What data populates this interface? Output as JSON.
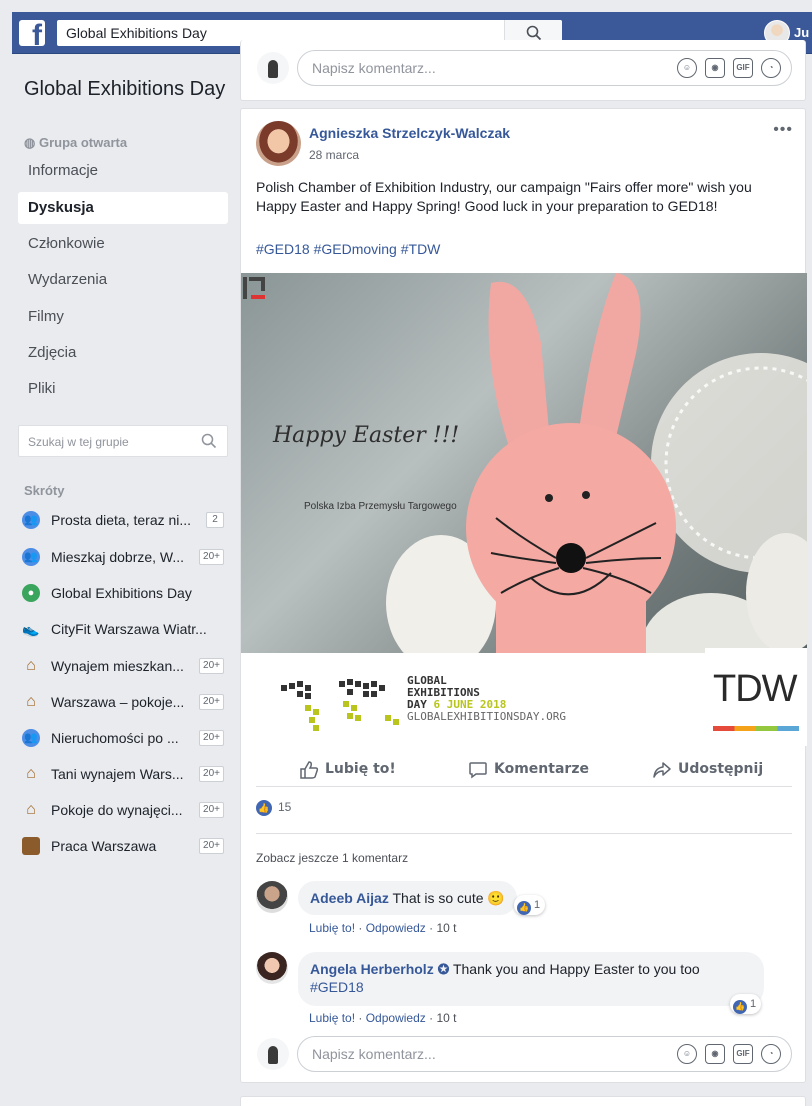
{
  "topbar": {
    "search_value": "Global Exhibitions Day",
    "user_short": "Ju"
  },
  "sidebar": {
    "group_title": "Global Exhibitions Day",
    "group_type": "Grupa otwarta",
    "nav": [
      "Informacje",
      "Dyskusja",
      "Członkowie",
      "Wydarzenia",
      "Filmy",
      "Zdjęcia",
      "Pliki"
    ],
    "active_nav": "Dyskusja",
    "search_placeholder": "Szukaj w tej grupie",
    "shortcuts_title": "Skróty",
    "shortcuts": [
      {
        "label": "Prosta dieta, teraz ni...",
        "badge": "2",
        "icon": "group-icon"
      },
      {
        "label": "Mieszkaj dobrze, W...",
        "badge": "20+",
        "icon": "group-icon"
      },
      {
        "label": "Global Exhibitions Day",
        "badge": "",
        "icon": "globe-icon"
      },
      {
        "label": "CityFit Warszawa Wiatr...",
        "badge": "",
        "icon": "shoe-icon"
      },
      {
        "label": "Wynajem mieszkan...",
        "badge": "20+",
        "icon": "house-icon"
      },
      {
        "label": "Warszawa – pokoje...",
        "badge": "20+",
        "icon": "house-icon"
      },
      {
        "label": "Nieruchomości po ...",
        "badge": "20+",
        "icon": "group-icon"
      },
      {
        "label": "Tani wynajem Wars...",
        "badge": "20+",
        "icon": "house-icon"
      },
      {
        "label": "Pokoje do wynajęci...",
        "badge": "20+",
        "icon": "house-icon"
      },
      {
        "label": "Praca Warszawa",
        "badge": "20+",
        "icon": "briefcase-icon"
      }
    ]
  },
  "comment_input": {
    "placeholder": "Napisz komentarz...",
    "gif_label": "GIF"
  },
  "post": {
    "author": "Agnieszka Strzelczyk-Walczak",
    "date": "28 marca",
    "text": "Polish Chamber of Exhibition Industry, our campaign \"Fairs offer more\" wish you Happy Easter and Happy Spring! Good luck in your preparation to GED18!",
    "tags": "#GED18 #GEDmoving #TDW",
    "image": {
      "happy_easter": "Happy Easter !!!",
      "pip": "Polska Izba Przemysłu Targowego",
      "ged_line1": "GLOBAL",
      "ged_line2": "EXHIBITIONS",
      "ged_line3a": "DAY ",
      "ged_line3b": "6 JUNE 2018",
      "ged_url": "GLOBALEXHIBITIONSDAY.ORG",
      "tdw": "TDW"
    },
    "actions": {
      "like": "Lubię to!",
      "comment": "Komentarze",
      "share": "Udostępnij"
    },
    "like_count": "15",
    "more_comments": "Zobacz jeszcze 1 komentarz",
    "comments": [
      {
        "author": "Adeeb Aijaz",
        "text": " That is so cute 🙂",
        "reactions": "1",
        "like": "Lubię to!",
        "reply": "Odpowiedz",
        "time": "10 t"
      },
      {
        "author": "Angela Herberholz",
        "text": " Thank you and Happy Easter to you too",
        "text2": "#GED18",
        "reactions": "1",
        "like": "Lubię to!",
        "reply": "Odpowiedz",
        "time": "10 t"
      }
    ]
  },
  "colors": {
    "brand": "#3b5998",
    "link": "#365899",
    "like": "#4267b2"
  }
}
